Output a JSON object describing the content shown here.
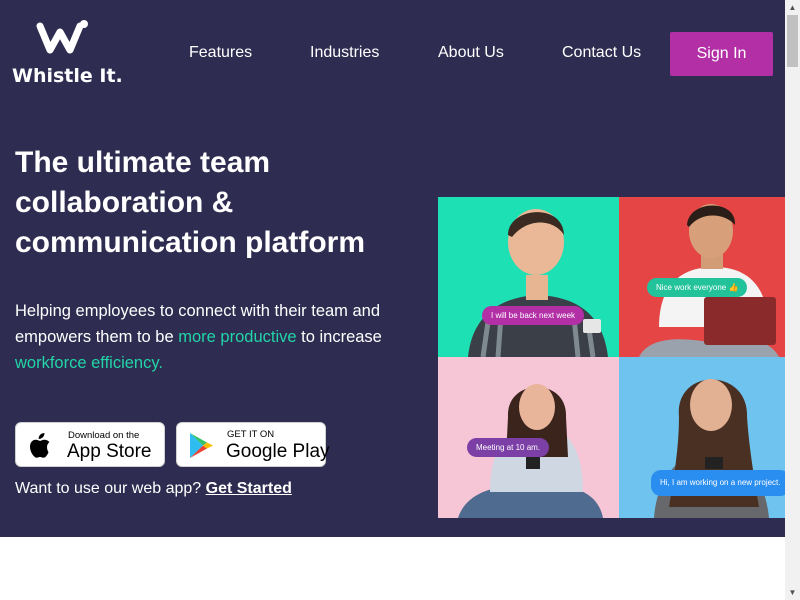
{
  "brand": {
    "name": "Whistle It."
  },
  "nav": {
    "items": [
      {
        "label": "Features"
      },
      {
        "label": "Industries"
      },
      {
        "label": "About Us"
      },
      {
        "label": "Contact Us"
      }
    ],
    "signin_label": "Sign In"
  },
  "hero": {
    "headline": "The ultimate team collaboration & communication platform",
    "sub_part1": "Helping employees to connect with their team and empowers them to be ",
    "sub_accent1": "more productive",
    "sub_part2": " to increase ",
    "sub_accent2": "workforce efficiency."
  },
  "badges": {
    "appstore": {
      "small": "Download on the",
      "big": "App Store"
    },
    "googleplay": {
      "small": "GET IT ON",
      "big": "Google Play"
    }
  },
  "webapp": {
    "prompt": "Want to use our web app? ",
    "link": "Get Started"
  },
  "bubbles": [
    {
      "text": "I will be back next week"
    },
    {
      "text": "Nice work everyone 👍"
    },
    {
      "text": "Meeting at 10 am."
    },
    {
      "text": "Hi, I am working on a new project."
    }
  ],
  "colors": {
    "hero_bg": "#2e2c50",
    "accent": "#22d5a8",
    "signin": "#b32fa6",
    "tile_green": "#1de0b4",
    "tile_red": "#e64545",
    "tile_pink": "#f7c6d6",
    "tile_blue": "#6ec3ef"
  },
  "icons": [
    "whistle-logo-icon",
    "apple-icon",
    "google-play-icon",
    "scroll-up-arrow-icon",
    "scroll-down-arrow-icon"
  ]
}
